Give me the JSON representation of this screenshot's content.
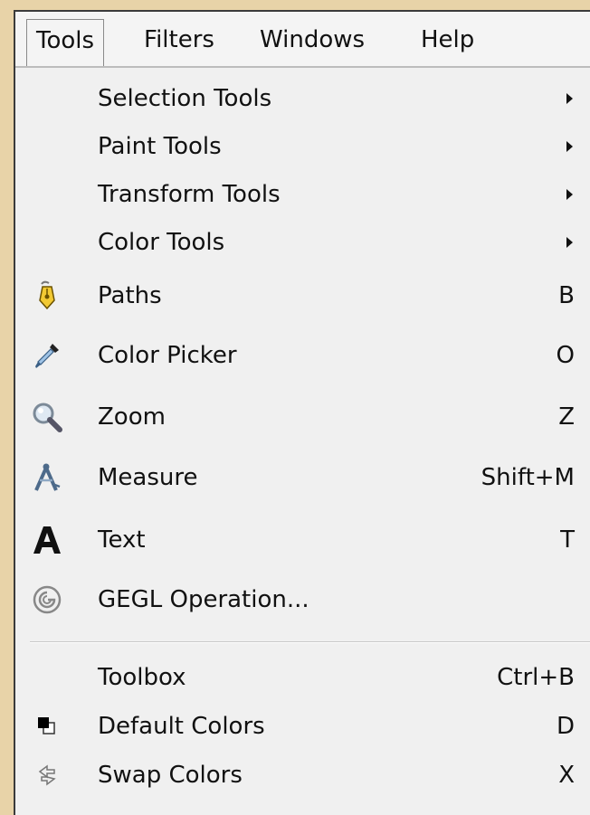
{
  "menubar": {
    "tools": "Tools",
    "filters": "Filters",
    "windows": "Windows",
    "help": "Help"
  },
  "menu": {
    "selection_tools": "Selection Tools",
    "paint_tools": "Paint Tools",
    "transform_tools": "Transform Tools",
    "color_tools": "Color Tools",
    "paths": {
      "label": "Paths",
      "shortcut": "B"
    },
    "color_picker": {
      "label": "Color Picker",
      "shortcut": "O"
    },
    "zoom": {
      "label": "Zoom",
      "shortcut": "Z"
    },
    "measure": {
      "label": "Measure",
      "shortcut": "Shift+M"
    },
    "text": {
      "label": "Text",
      "shortcut": "T"
    },
    "gegl": {
      "label": "GEGL Operation..."
    },
    "toolbox": {
      "label": "Toolbox",
      "shortcut": "Ctrl+B"
    },
    "default_colors": {
      "label": "Default Colors",
      "shortcut": "D"
    },
    "swap_colors": {
      "label": "Swap Colors",
      "shortcut": "X"
    }
  },
  "colors": {
    "background": "#e8d3a8",
    "menu_bg": "#f0f0f0",
    "text": "#111111"
  }
}
